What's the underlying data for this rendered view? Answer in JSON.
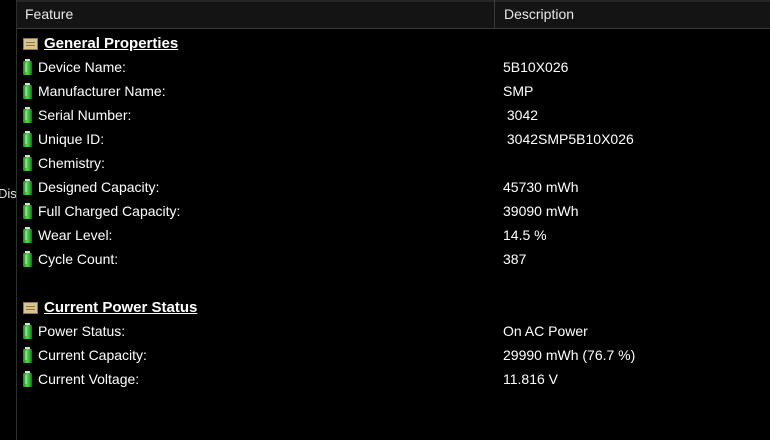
{
  "clipped_left_text": "Dis",
  "header": {
    "feature": "Feature",
    "description": "Description"
  },
  "groups": [
    {
      "title": "General Properties",
      "icon": "folder-icon",
      "items": [
        {
          "feature": "Device Name:",
          "value": "5B10X026"
        },
        {
          "feature": "Manufacturer Name:",
          "value": "SMP"
        },
        {
          "feature": "Serial Number:",
          "value": " 3042"
        },
        {
          "feature": "Unique ID:",
          "value": " 3042SMP5B10X026"
        },
        {
          "feature": "Chemistry:",
          "value": ""
        },
        {
          "feature": "Designed Capacity:",
          "value": "45730 mWh"
        },
        {
          "feature": "Full Charged Capacity:",
          "value": "39090 mWh"
        },
        {
          "feature": "Wear Level:",
          "value": "14.5 %"
        },
        {
          "feature": "Cycle Count:",
          "value": "387"
        }
      ]
    },
    {
      "title": "Current Power Status",
      "icon": "folder-icon",
      "items": [
        {
          "feature": "Power Status:",
          "value": "On AC Power"
        },
        {
          "feature": "Current Capacity:",
          "value": "29990 mWh (76.7 %)"
        },
        {
          "feature": "Current Voltage:",
          "value": "11.816 V"
        }
      ]
    }
  ],
  "colors": {
    "background": "#000000",
    "header_bg": "#141414",
    "text": "#ffffff",
    "battery_green": "#3fcf3c"
  }
}
